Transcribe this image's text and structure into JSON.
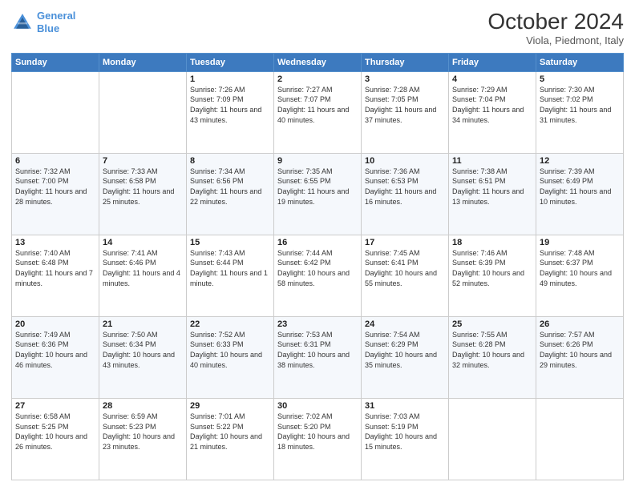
{
  "header": {
    "logo_line1": "General",
    "logo_line2": "Blue",
    "title": "October 2024",
    "subtitle": "Viola, Piedmont, Italy"
  },
  "weekdays": [
    "Sunday",
    "Monday",
    "Tuesday",
    "Wednesday",
    "Thursday",
    "Friday",
    "Saturday"
  ],
  "weeks": [
    [
      {
        "day": "",
        "sunrise": "",
        "sunset": "",
        "daylight": ""
      },
      {
        "day": "",
        "sunrise": "",
        "sunset": "",
        "daylight": ""
      },
      {
        "day": "1",
        "sunrise": "Sunrise: 7:26 AM",
        "sunset": "Sunset: 7:09 PM",
        "daylight": "Daylight: 11 hours and 43 minutes."
      },
      {
        "day": "2",
        "sunrise": "Sunrise: 7:27 AM",
        "sunset": "Sunset: 7:07 PM",
        "daylight": "Daylight: 11 hours and 40 minutes."
      },
      {
        "day": "3",
        "sunrise": "Sunrise: 7:28 AM",
        "sunset": "Sunset: 7:05 PM",
        "daylight": "Daylight: 11 hours and 37 minutes."
      },
      {
        "day": "4",
        "sunrise": "Sunrise: 7:29 AM",
        "sunset": "Sunset: 7:04 PM",
        "daylight": "Daylight: 11 hours and 34 minutes."
      },
      {
        "day": "5",
        "sunrise": "Sunrise: 7:30 AM",
        "sunset": "Sunset: 7:02 PM",
        "daylight": "Daylight: 11 hours and 31 minutes."
      }
    ],
    [
      {
        "day": "6",
        "sunrise": "Sunrise: 7:32 AM",
        "sunset": "Sunset: 7:00 PM",
        "daylight": "Daylight: 11 hours and 28 minutes."
      },
      {
        "day": "7",
        "sunrise": "Sunrise: 7:33 AM",
        "sunset": "Sunset: 6:58 PM",
        "daylight": "Daylight: 11 hours and 25 minutes."
      },
      {
        "day": "8",
        "sunrise": "Sunrise: 7:34 AM",
        "sunset": "Sunset: 6:56 PM",
        "daylight": "Daylight: 11 hours and 22 minutes."
      },
      {
        "day": "9",
        "sunrise": "Sunrise: 7:35 AM",
        "sunset": "Sunset: 6:55 PM",
        "daylight": "Daylight: 11 hours and 19 minutes."
      },
      {
        "day": "10",
        "sunrise": "Sunrise: 7:36 AM",
        "sunset": "Sunset: 6:53 PM",
        "daylight": "Daylight: 11 hours and 16 minutes."
      },
      {
        "day": "11",
        "sunrise": "Sunrise: 7:38 AM",
        "sunset": "Sunset: 6:51 PM",
        "daylight": "Daylight: 11 hours and 13 minutes."
      },
      {
        "day": "12",
        "sunrise": "Sunrise: 7:39 AM",
        "sunset": "Sunset: 6:49 PM",
        "daylight": "Daylight: 11 hours and 10 minutes."
      }
    ],
    [
      {
        "day": "13",
        "sunrise": "Sunrise: 7:40 AM",
        "sunset": "Sunset: 6:48 PM",
        "daylight": "Daylight: 11 hours and 7 minutes."
      },
      {
        "day": "14",
        "sunrise": "Sunrise: 7:41 AM",
        "sunset": "Sunset: 6:46 PM",
        "daylight": "Daylight: 11 hours and 4 minutes."
      },
      {
        "day": "15",
        "sunrise": "Sunrise: 7:43 AM",
        "sunset": "Sunset: 6:44 PM",
        "daylight": "Daylight: 11 hours and 1 minute."
      },
      {
        "day": "16",
        "sunrise": "Sunrise: 7:44 AM",
        "sunset": "Sunset: 6:42 PM",
        "daylight": "Daylight: 10 hours and 58 minutes."
      },
      {
        "day": "17",
        "sunrise": "Sunrise: 7:45 AM",
        "sunset": "Sunset: 6:41 PM",
        "daylight": "Daylight: 10 hours and 55 minutes."
      },
      {
        "day": "18",
        "sunrise": "Sunrise: 7:46 AM",
        "sunset": "Sunset: 6:39 PM",
        "daylight": "Daylight: 10 hours and 52 minutes."
      },
      {
        "day": "19",
        "sunrise": "Sunrise: 7:48 AM",
        "sunset": "Sunset: 6:37 PM",
        "daylight": "Daylight: 10 hours and 49 minutes."
      }
    ],
    [
      {
        "day": "20",
        "sunrise": "Sunrise: 7:49 AM",
        "sunset": "Sunset: 6:36 PM",
        "daylight": "Daylight: 10 hours and 46 minutes."
      },
      {
        "day": "21",
        "sunrise": "Sunrise: 7:50 AM",
        "sunset": "Sunset: 6:34 PM",
        "daylight": "Daylight: 10 hours and 43 minutes."
      },
      {
        "day": "22",
        "sunrise": "Sunrise: 7:52 AM",
        "sunset": "Sunset: 6:33 PM",
        "daylight": "Daylight: 10 hours and 40 minutes."
      },
      {
        "day": "23",
        "sunrise": "Sunrise: 7:53 AM",
        "sunset": "Sunset: 6:31 PM",
        "daylight": "Daylight: 10 hours and 38 minutes."
      },
      {
        "day": "24",
        "sunrise": "Sunrise: 7:54 AM",
        "sunset": "Sunset: 6:29 PM",
        "daylight": "Daylight: 10 hours and 35 minutes."
      },
      {
        "day": "25",
        "sunrise": "Sunrise: 7:55 AM",
        "sunset": "Sunset: 6:28 PM",
        "daylight": "Daylight: 10 hours and 32 minutes."
      },
      {
        "day": "26",
        "sunrise": "Sunrise: 7:57 AM",
        "sunset": "Sunset: 6:26 PM",
        "daylight": "Daylight: 10 hours and 29 minutes."
      }
    ],
    [
      {
        "day": "27",
        "sunrise": "Sunrise: 6:58 AM",
        "sunset": "Sunset: 5:25 PM",
        "daylight": "Daylight: 10 hours and 26 minutes."
      },
      {
        "day": "28",
        "sunrise": "Sunrise: 6:59 AM",
        "sunset": "Sunset: 5:23 PM",
        "daylight": "Daylight: 10 hours and 23 minutes."
      },
      {
        "day": "29",
        "sunrise": "Sunrise: 7:01 AM",
        "sunset": "Sunset: 5:22 PM",
        "daylight": "Daylight: 10 hours and 21 minutes."
      },
      {
        "day": "30",
        "sunrise": "Sunrise: 7:02 AM",
        "sunset": "Sunset: 5:20 PM",
        "daylight": "Daylight: 10 hours and 18 minutes."
      },
      {
        "day": "31",
        "sunrise": "Sunrise: 7:03 AM",
        "sunset": "Sunset: 5:19 PM",
        "daylight": "Daylight: 10 hours and 15 minutes."
      },
      {
        "day": "",
        "sunrise": "",
        "sunset": "",
        "daylight": ""
      },
      {
        "day": "",
        "sunrise": "",
        "sunset": "",
        "daylight": ""
      }
    ]
  ]
}
